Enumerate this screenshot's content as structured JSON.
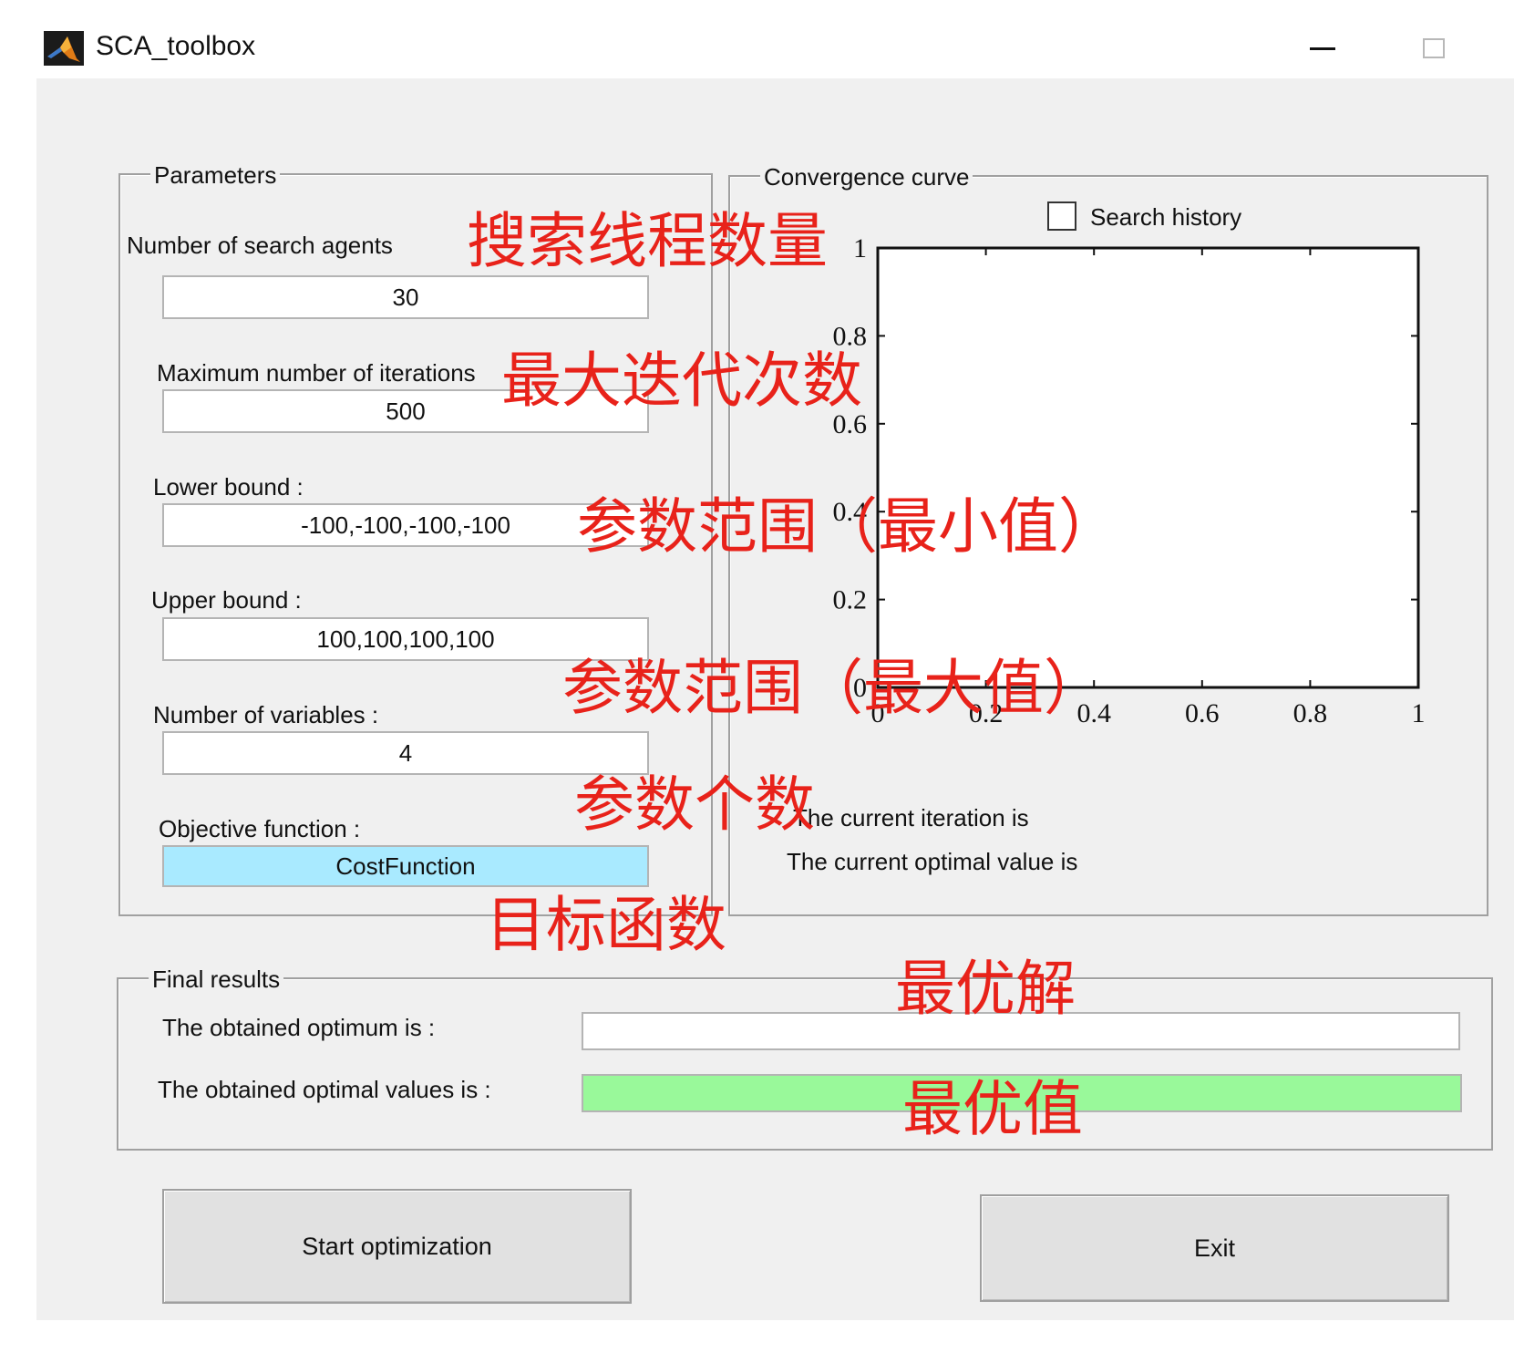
{
  "window": {
    "title": "SCA_toolbox"
  },
  "parameters": {
    "title": "Parameters",
    "agents": {
      "label": "Number of search agents",
      "value": "30"
    },
    "iterations": {
      "label": "Maximum number of iterations",
      "value": "500"
    },
    "lower": {
      "label": "Lower bound :",
      "value": "-100,-100,-100,-100"
    },
    "upper": {
      "label": "Upper bound :",
      "value": "100,100,100,100"
    },
    "variables": {
      "label": "Number of variables :",
      "value": "4"
    },
    "objective": {
      "label": "Objective function :",
      "value": "CostFunction"
    }
  },
  "convergence": {
    "title": "Convergence curve",
    "search_history_label": "Search history",
    "search_history_checked": false,
    "current_iteration_label": "The current iteration is",
    "current_value_label": "The current optimal value is"
  },
  "final": {
    "title": "Final results",
    "optimum_label": "The obtained optimum is :",
    "optimum_value": "",
    "values_label": "The obtained optimal values is :",
    "values_value": ""
  },
  "buttons": {
    "start": "Start optimization",
    "exit": "Exit"
  },
  "annotations": {
    "agents": "搜索线程数量",
    "iterations": "最大迭代次数",
    "lower": "参数范围（最小值）",
    "upper": "参数范围（最大值）",
    "variables": "参数个数",
    "objective": "目标函数",
    "optimum": "最优解",
    "values": "最优值"
  },
  "colors": {
    "annotation": "#e8221a",
    "objective_button": "#a9eaff",
    "result_green": "#99f99a"
  },
  "chart_data": {
    "type": "line",
    "series": [],
    "xlim": [
      0,
      1
    ],
    "ylim": [
      0,
      1
    ],
    "x_ticks": [
      "0",
      "0.2",
      "0.4",
      "0.6",
      "0.8",
      "1"
    ],
    "y_ticks": [
      "0",
      "0.2",
      "0.4",
      "0.6",
      "0.8",
      "1"
    ],
    "grid": false
  }
}
